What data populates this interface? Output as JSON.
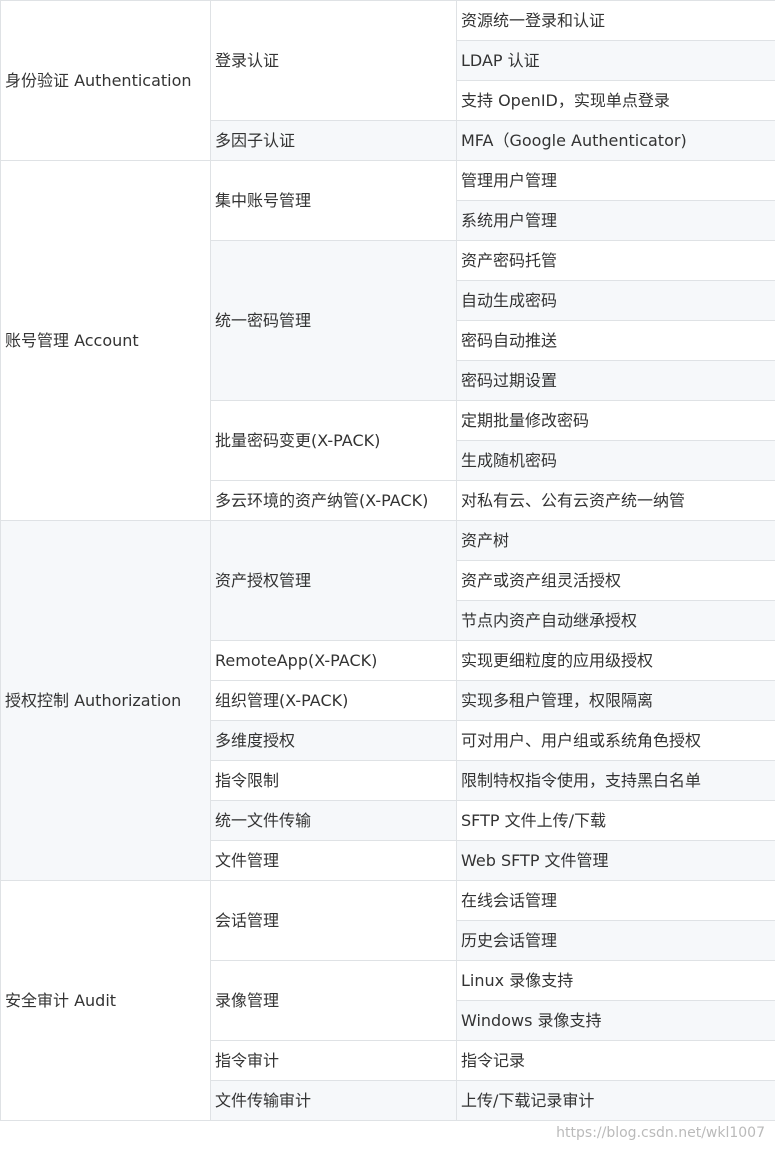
{
  "sections": [
    {
      "name": "身份验证 Authentication",
      "groups": [
        {
          "name": "登录认证",
          "items": [
            "资源统一登录和认证",
            "LDAP 认证",
            "支持 OpenID，实现单点登录"
          ]
        },
        {
          "name": "多因子认证",
          "items": [
            "MFA（Google Authenticator)"
          ]
        }
      ]
    },
    {
      "name": "账号管理 Account",
      "groups": [
        {
          "name": "集中账号管理",
          "items": [
            "管理用户管理",
            "系统用户管理"
          ]
        },
        {
          "name": "统一密码管理",
          "items": [
            "资产密码托管",
            "自动生成密码",
            "密码自动推送",
            "密码过期设置"
          ]
        },
        {
          "name": "批量密码变更(X-PACK)",
          "items": [
            "定期批量修改密码",
            "生成随机密码"
          ]
        },
        {
          "name": "多云环境的资产纳管(X-PACK)",
          "items": [
            "对私有云、公有云资产统一纳管"
          ]
        }
      ]
    },
    {
      "name": "授权控制 Authorization",
      "groups": [
        {
          "name": "资产授权管理",
          "items": [
            "资产树",
            "资产或资产组灵活授权",
            "节点内资产自动继承授权"
          ]
        },
        {
          "name": "RemoteApp(X-PACK)",
          "items": [
            "实现更细粒度的应用级授权"
          ]
        },
        {
          "name": "组织管理(X-PACK)",
          "items": [
            "实现多租户管理，权限隔离"
          ]
        },
        {
          "name": "多维度授权",
          "items": [
            "可对用户、用户组或系统角色授权"
          ]
        },
        {
          "name": "指令限制",
          "items": [
            "限制特权指令使用，支持黑白名单"
          ]
        },
        {
          "name": "统一文件传输",
          "items": [
            "SFTP 文件上传/下载"
          ]
        },
        {
          "name": "文件管理",
          "items": [
            "Web SFTP 文件管理"
          ]
        }
      ]
    },
    {
      "name": "安全审计 Audit",
      "groups": [
        {
          "name": "会话管理",
          "items": [
            "在线会话管理",
            "历史会话管理"
          ]
        },
        {
          "name": "录像管理",
          "items": [
            "Linux 录像支持",
            "Windows 录像支持"
          ]
        },
        {
          "name": "指令审计",
          "items": [
            "指令记录"
          ]
        },
        {
          "name": "文件传输审计",
          "items": [
            "上传/下载记录审计"
          ]
        }
      ]
    }
  ],
  "watermark": "https://blog.csdn.net/wkl1007",
  "colors": {
    "border": "#dfe2e5",
    "stripe": "#f6f8fa",
    "text": "#333333"
  }
}
